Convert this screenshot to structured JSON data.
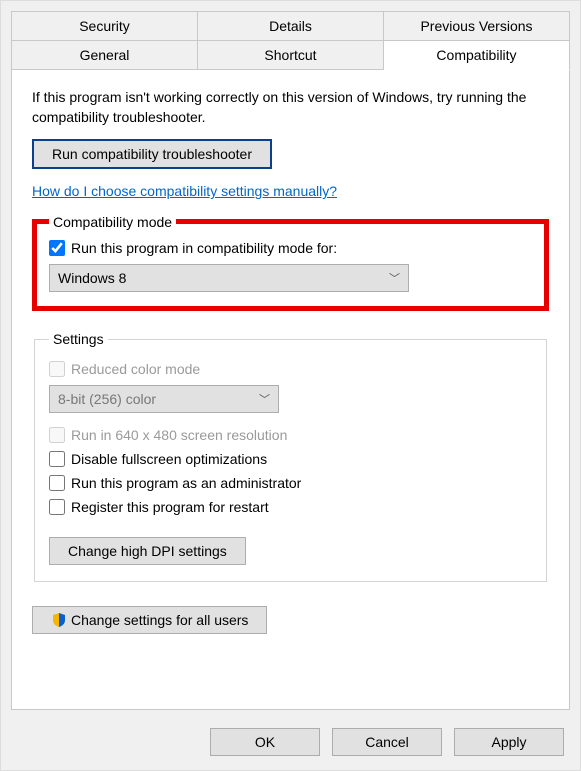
{
  "tabs_row1": {
    "security": "Security",
    "details": "Details",
    "previous": "Previous Versions"
  },
  "tabs_row2": {
    "general": "General",
    "shortcut": "Shortcut",
    "compatibility": "Compatibility"
  },
  "intro": "If this program isn't working correctly on this version of Windows, try running the compatibility troubleshooter.",
  "troubleshoot_btn": "Run compatibility troubleshooter",
  "help_link": "How do I choose compatibility settings manually?",
  "compat_mode": {
    "legend": "Compatibility mode",
    "checkbox_label": "Run this program in compatibility mode for:",
    "selected": "Windows 8"
  },
  "settings": {
    "legend": "Settings",
    "reduced_color": "Reduced color mode",
    "color_select": "8-bit (256) color",
    "low_res": "Run in 640 x 480 screen resolution",
    "disable_fullscreen": "Disable fullscreen optimizations",
    "run_admin": "Run this program as an administrator",
    "register_restart": "Register this program for restart",
    "dpi_btn": "Change high DPI settings"
  },
  "all_users_btn": "Change settings for all users",
  "actions": {
    "ok": "OK",
    "cancel": "Cancel",
    "apply": "Apply"
  }
}
